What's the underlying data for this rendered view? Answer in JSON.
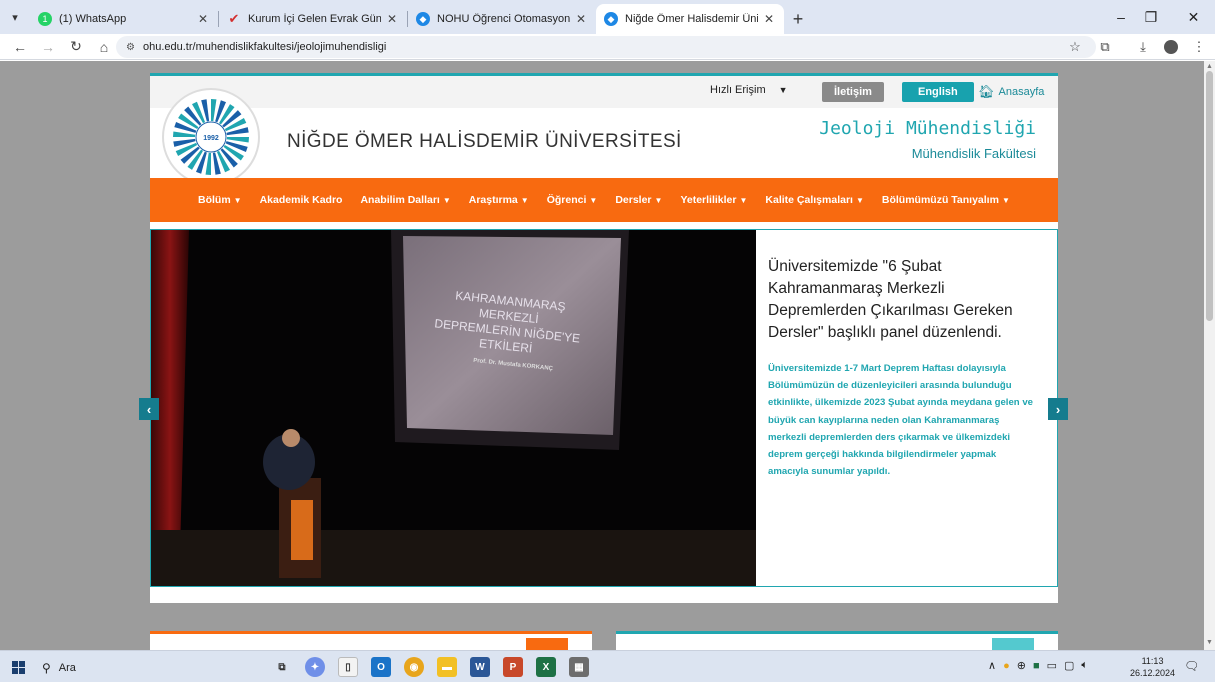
{
  "browser": {
    "tabs": [
      {
        "label": "(1) WhatsApp",
        "favicon_color": "#25d366",
        "badge": "1",
        "active": false
      },
      {
        "label": "Kurum İçi Gelen Evrak Güncelle",
        "favicon_color": "#d32f2f",
        "active": false
      },
      {
        "label": "NOHU Öğrenci Otomasyon Sist",
        "favicon_color": "#1e88e5",
        "active": false
      },
      {
        "label": "Niğde Ömer Halisdemir Üniver",
        "favicon_color": "#1e88e5",
        "active": true
      }
    ],
    "url": "ohu.edu.tr/muhendislikfakultesi/jeolojimuhendisligi"
  },
  "site": {
    "header": {
      "quick_access": "Hızlı Erişim",
      "contact_label": "İletişim",
      "english_label": "English",
      "home_label": "Anasayfa",
      "university_name": "NİĞDE ÖMER HALİSDEMİR ÜNİVERSİTESİ",
      "department": "Jeoloji Mühendisliği",
      "faculty": "Mühendislik Fakültesi",
      "logo": {
        "year": "1992",
        "ring_text": "NİĞDE ÖMER HALİSDEMİR ÜNİVERSİTESİ"
      }
    },
    "menu": [
      {
        "label": "Bölüm",
        "dropdown": true
      },
      {
        "label": "Akademik Kadro",
        "dropdown": false
      },
      {
        "label": "Anabilim Dalları",
        "dropdown": true
      },
      {
        "label": "Araştırma",
        "dropdown": true
      },
      {
        "label": "Öğrenci",
        "dropdown": true
      },
      {
        "label": "Dersler",
        "dropdown": true
      },
      {
        "label": "Yeterlilikler",
        "dropdown": true
      },
      {
        "label": "Kalite Çalışmaları",
        "dropdown": true
      },
      {
        "label": "Bölümümüzü Tanıyalım",
        "dropdown": true
      }
    ],
    "slide": {
      "projection_title": "KAHRAMANMARAŞ MERKEZLİ DEPREMLERİN NİĞDE'YE ETKİLERİ",
      "projection_presenter": "Prof. Dr. Mustafa KORKANÇ",
      "heading": "Üniversitemizde \"6 Şubat Kahramanmaraş Merkezli Depremlerden Çıkarılması Gereken Dersler\" başlıklı panel düzenlendi.",
      "body": "Üniversitemizde 1-7 Mart Deprem Haftası dolayısıyla Bölümümüzün de düzenleyicileri arasında bulunduğu etkinlikte, ülkemizde 2023 Şubat ayında meydana gelen ve büyük can kayıplarına neden olan Kahramanmaraş merkezli depremlerden ders çıkarmak ve ülkemizdeki deprem gerçeği hakkında bilgilendirmeler yapmak amacıyla sunumlar yapıldı."
    },
    "colors": {
      "accent_teal": "#20a6b0",
      "menu_orange": "#f86a10",
      "contact_grey": "#8a8a8a",
      "english_teal": "#18a2ae"
    }
  },
  "taskbar": {
    "search_label": "Ara",
    "time": "11:13",
    "date": "26.12.2024"
  }
}
